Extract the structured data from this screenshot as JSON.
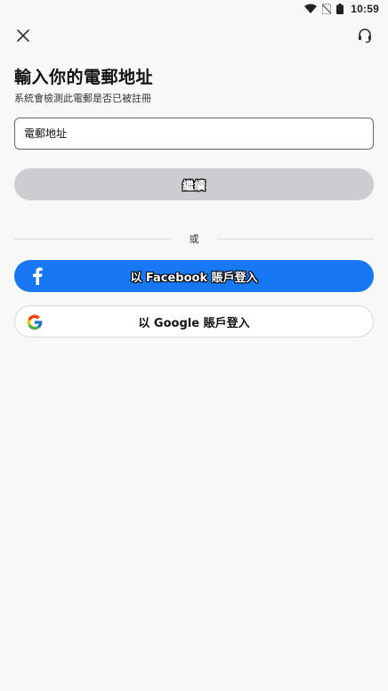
{
  "status_bar": {
    "time": "10:59",
    "icons": [
      "wifi-icon",
      "no-sim-icon",
      "battery-icon"
    ]
  },
  "header": {
    "close_icon": "close-icon",
    "support_icon": "headset-icon"
  },
  "main": {
    "title": "輸入你的電郵地址",
    "subtitle": "系統會檢測此電郵是否已被註冊",
    "email_placeholder": "電郵地址",
    "continue_label": "繼續",
    "divider_text": "或",
    "facebook_label": "以 Facebook 賬戶登入",
    "google_label": "以 Google 賬戶登入"
  },
  "colors": {
    "facebook_blue": "#1877f2",
    "continue_disabled": "#cdcdcf",
    "background": "#f8f8f8"
  }
}
